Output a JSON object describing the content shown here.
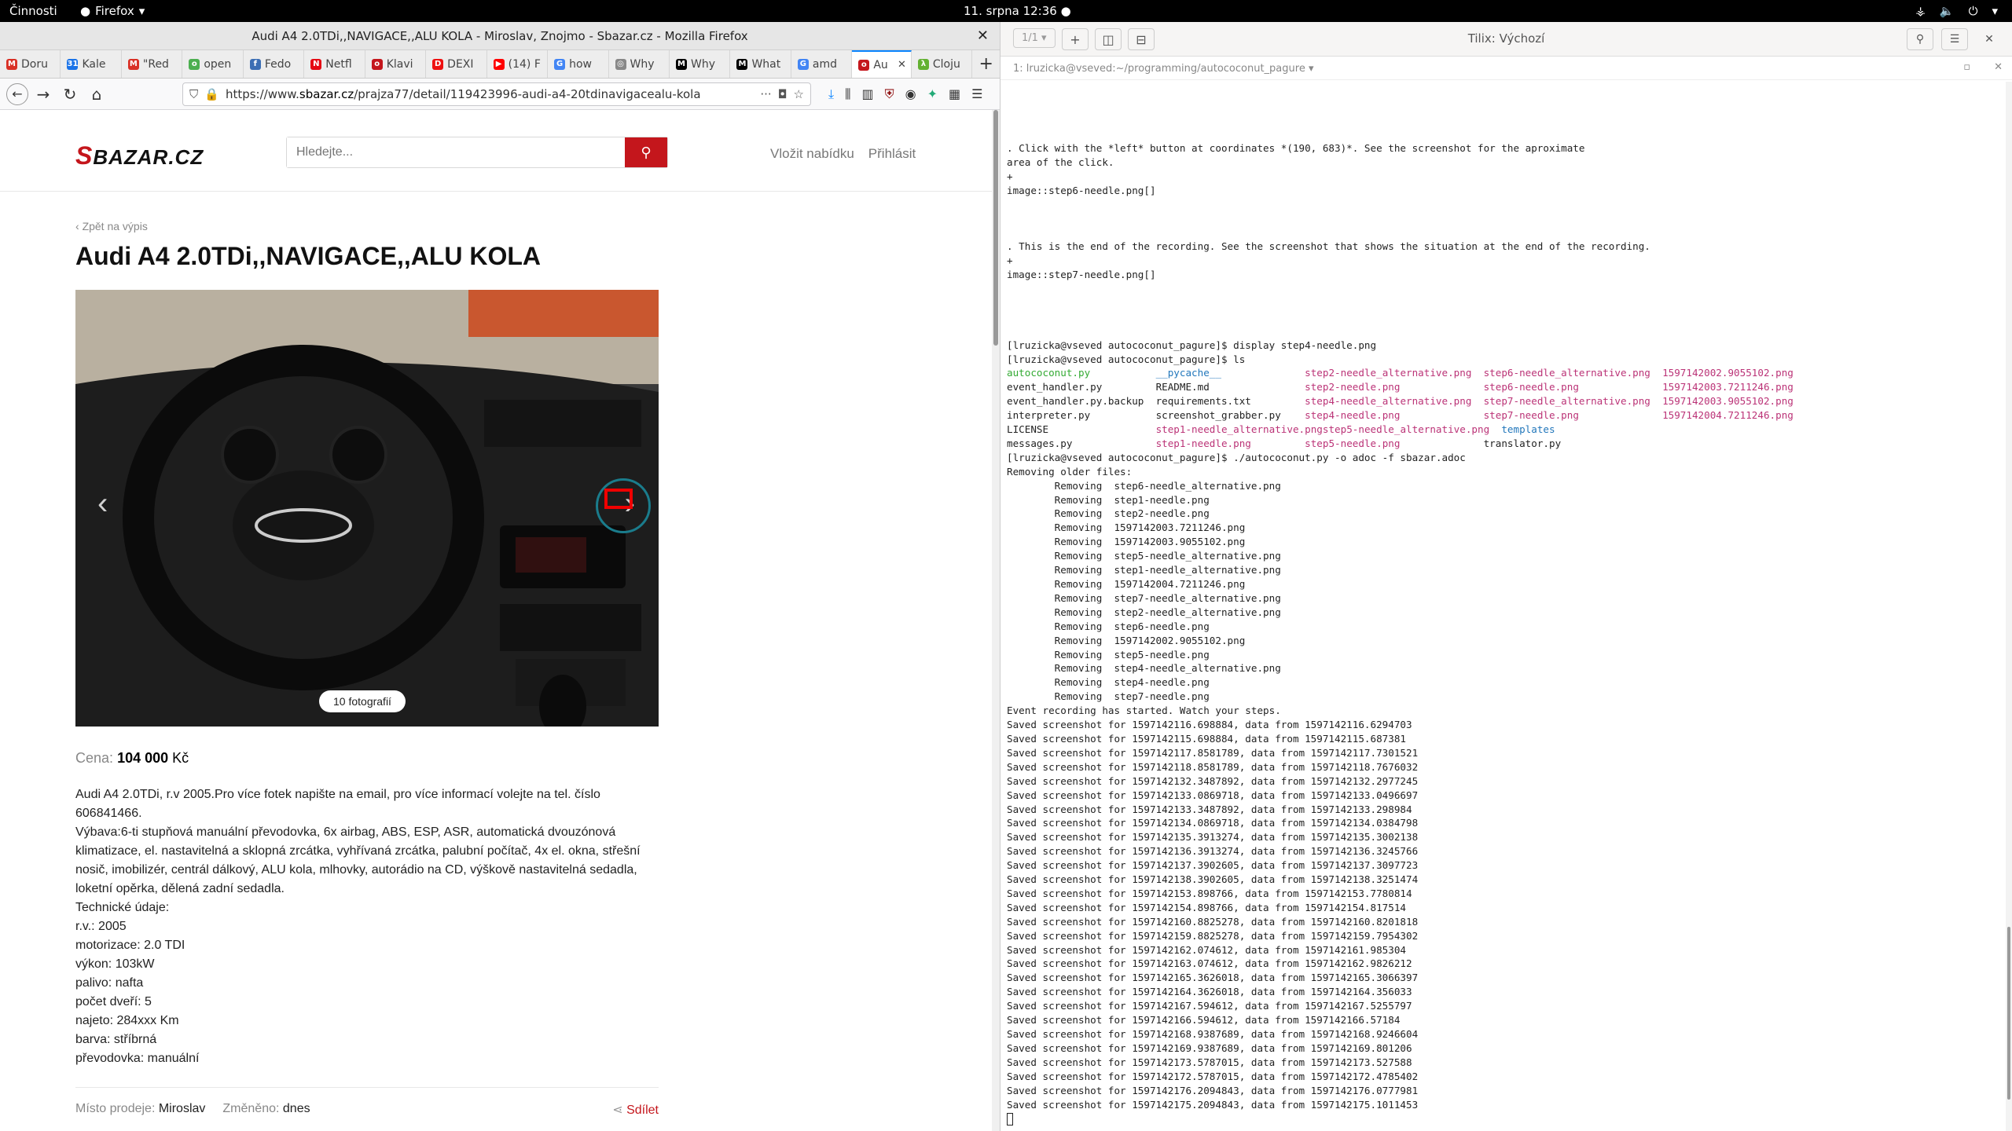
{
  "system_bar": {
    "activities": "Činnosti",
    "app": "Firefox",
    "clock": "11. srpna  12:36"
  },
  "firefox": {
    "window_title": "Audi A4 2.0TDi,,NAVIGACE,,ALU KOLA - Miroslav, Znojmo - Sbazar.cz - Mozilla Firefox",
    "tabs": [
      {
        "label": "Doru",
        "color": "#d93025",
        "glyph": "M"
      },
      {
        "label": "Kale",
        "color": "#1a73e8",
        "glyph": "31"
      },
      {
        "label": "\"Red",
        "color": "#d93025",
        "glyph": "M"
      },
      {
        "label": "open",
        "color": "#4caf50",
        "glyph": "o"
      },
      {
        "label": "Fedo",
        "color": "#3c6eb4",
        "glyph": "f"
      },
      {
        "label": "Netfl",
        "color": "#e50914",
        "glyph": "N"
      },
      {
        "label": "Klavi",
        "color": "#c4161c",
        "glyph": "o"
      },
      {
        "label": "DEXI",
        "color": "#e11",
        "glyph": "D"
      },
      {
        "label": "(14) F",
        "color": "#f00",
        "glyph": "▶"
      },
      {
        "label": "how ",
        "color": "#4285f4",
        "glyph": "G"
      },
      {
        "label": "Why ",
        "color": "#888",
        "glyph": "◎"
      },
      {
        "label": "Why ",
        "color": "#000",
        "glyph": "M"
      },
      {
        "label": "What",
        "color": "#000",
        "glyph": "M"
      },
      {
        "label": "amd ",
        "color": "#4285f4",
        "glyph": "G"
      },
      {
        "label": "Au",
        "color": "#c4161c",
        "glyph": "o"
      },
      {
        "label": "Cloju",
        "color": "#63b132",
        "glyph": "λ"
      }
    ],
    "url_host": "https://www.",
    "url_domain": "sbazar.cz",
    "url_path": "/prajza77/detail/119423996-audi-a4-20tdinavigacealu-kola"
  },
  "page": {
    "search_placeholder": "Hledejte...",
    "link_new_offer": "Vložit nabídku",
    "link_login": "Přihlásit",
    "back_link": "Zpět na výpis",
    "title": "Audi A4 2.0TDi,,NAVIGACE,,ALU KOLA",
    "photos_count": "10 fotografií",
    "price_label": "Cena:",
    "price_value": "104 000",
    "price_currency": "Kč",
    "description": "Audi A4 2.0TDi, r.v 2005.Pro více fotek napište na email, pro více informací volejte na tel. číslo 606841466.\nVýbava:6-ti stupňová manuální převodovka, 6x airbag, ABS, ESP, ASR, automatická dvouzónová klimatizace, el. nastavitelná a sklopná zrcátka, vyhřívaná zrcátka, palubní počítač, 4x el. okna, střešní nosič, imobilizér, centrál dálkový, ALU kola, mlhovky, autorádio na CD, výškově nastavitelná sedadla, loketní opěrka, dělená zadní sedadla.\nTechnické údaje:\nr.v.: 2005\nmotorizace: 2.0 TDI\nvýkon: 103kW\npalivo: nafta\npočet dveří: 5\nnajeto: 284xxx Km\nbarva: stříbrná\npřevodovka: manuální",
    "place_label": "Místo prodeje:",
    "place_value": "Miroslav",
    "changed_label": "Změněno:",
    "changed_value": "dnes",
    "share": "Sdílet"
  },
  "terminal": {
    "title": "Tilix: Výchozí",
    "page_indicator": "1/1",
    "session": "1: lruzicka@vseved:~/programming/autococonut_pagure",
    "lines_top": [
      "",
      ". Click with the *left* button at coordinates *(190, 683)*. See the screenshot for the aproximate",
      "area of the click.",
      "+",
      "image::step6-needle.png[]",
      "",
      "",
      "",
      ". This is the end of the recording. See the screenshot that shows the situation at the end of the recording.",
      "+",
      "image::step7-needle.png[]",
      "",
      "",
      "",
      "",
      "[lruzicka@vseved autococonut_pagure]$ display step4-needle.png",
      "[lruzicka@vseved autococonut_pagure]$ ls"
    ],
    "ls_rows": [
      [
        "autococonut.py",
        "__pycache__",
        "step2-needle_alternative.png",
        "step6-needle_alternative.png",
        "1597142002.9055102.png"
      ],
      [
        "event_handler.py",
        "README.md",
        "step2-needle.png",
        "step6-needle.png",
        "1597142003.7211246.png"
      ],
      [
        "event_handler.py.backup",
        "requirements.txt",
        "step4-needle_alternative.png",
        "step7-needle_alternative.png",
        "1597142003.9055102.png"
      ],
      [
        "interpreter.py",
        "screenshot_grabber.py",
        "step4-needle.png",
        "step7-needle.png",
        "1597142004.7211246.png"
      ],
      [
        "LICENSE",
        "step1-needle_alternative.png",
        "step5-needle_alternative.png",
        "templates",
        ""
      ],
      [
        "messages.py",
        "step1-needle.png",
        "step5-needle.png",
        "translator.py",
        ""
      ]
    ],
    "lines_bottom": [
      "[lruzicka@vseved autococonut_pagure]$ ./autococonut.py -o adoc -f sbazar.adoc",
      "Removing older files:",
      "        Removing  step6-needle_alternative.png",
      "        Removing  step1-needle.png",
      "        Removing  step2-needle.png",
      "        Removing  1597142003.7211246.png",
      "        Removing  1597142003.9055102.png",
      "        Removing  step5-needle_alternative.png",
      "        Removing  step1-needle_alternative.png",
      "        Removing  1597142004.7211246.png",
      "        Removing  step7-needle_alternative.png",
      "        Removing  step2-needle_alternative.png",
      "        Removing  step6-needle.png",
      "        Removing  1597142002.9055102.png",
      "        Removing  step5-needle.png",
      "        Removing  step4-needle_alternative.png",
      "        Removing  step4-needle.png",
      "        Removing  step7-needle.png",
      "Event recording has started. Watch your steps.",
      "Saved screenshot for 1597142116.698884, data from 1597142116.6294703",
      "Saved screenshot for 1597142115.698884, data from 1597142115.687381",
      "Saved screenshot for 1597142117.8581789, data from 1597142117.7301521",
      "Saved screenshot for 1597142118.8581789, data from 1597142118.7676032",
      "Saved screenshot for 1597142132.3487892, data from 1597142132.2977245",
      "Saved screenshot for 1597142133.0869718, data from 1597142133.0496697",
      "Saved screenshot for 1597142133.3487892, data from 1597142133.298984",
      "Saved screenshot for 1597142134.0869718, data from 1597142134.0384798",
      "Saved screenshot for 1597142135.3913274, data from 1597142135.3002138",
      "Saved screenshot for 1597142136.3913274, data from 1597142136.3245766",
      "Saved screenshot for 1597142137.3902605, data from 1597142137.3097723",
      "Saved screenshot for 1597142138.3902605, data from 1597142138.3251474",
      "Saved screenshot for 1597142153.898766, data from 1597142153.7780814",
      "Saved screenshot for 1597142154.898766, data from 1597142154.817514",
      "Saved screenshot for 1597142160.8825278, data from 1597142160.8201818",
      "Saved screenshot for 1597142159.8825278, data from 1597142159.7954302",
      "Saved screenshot for 1597142162.074612, data from 1597142161.985304",
      "Saved screenshot for 1597142163.074612, data from 1597142162.9826212",
      "Saved screenshot for 1597142165.3626018, data from 1597142165.3066397",
      "Saved screenshot for 1597142164.3626018, data from 1597142164.356033",
      "Saved screenshot for 1597142167.594612, data from 1597142167.5255797",
      "Saved screenshot for 1597142166.594612, data from 1597142166.57184",
      "Saved screenshot for 1597142168.9387689, data from 1597142168.9246604",
      "Saved screenshot for 1597142169.9387689, data from 1597142169.801206",
      "Saved screenshot for 1597142173.5787015, data from 1597142173.527588",
      "Saved screenshot for 1597142172.5787015, data from 1597142172.4785402",
      "Saved screenshot for 1597142176.2094843, data from 1597142176.0777981",
      "Saved screenshot for 1597142175.2094843, data from 1597142175.1011453"
    ]
  }
}
